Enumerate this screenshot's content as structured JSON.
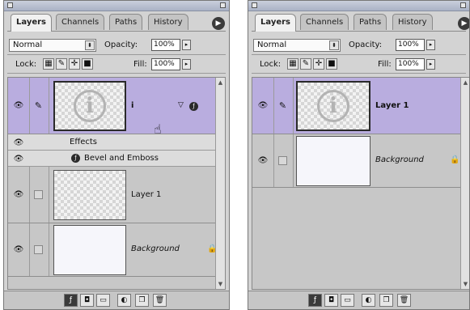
{
  "panels": [
    {
      "tabs": [
        "Layers",
        "Channels",
        "Paths",
        "History"
      ],
      "blend_mode": "Normal",
      "opacity_label": "Opacity:",
      "opacity_value": "100%",
      "lock_label": "Lock:",
      "fill_label": "Fill:",
      "fill_value": "100%",
      "layers": {
        "top_name": "i",
        "effects_label": "Effects",
        "effect_name": "Bevel and Emboss",
        "layer1_name": "Layer 1",
        "background_name": "Background"
      }
    },
    {
      "tabs": [
        "Layers",
        "Channels",
        "Paths",
        "History"
      ],
      "blend_mode": "Normal",
      "opacity_label": "Opacity:",
      "opacity_value": "100%",
      "lock_label": "Lock:",
      "fill_label": "Fill:",
      "fill_value": "100%",
      "layers": {
        "layer1_name": "Layer 1",
        "background_name": "Background"
      }
    }
  ],
  "icons": {
    "eye": "eye-icon",
    "brush": "brush-icon",
    "lock": "lock-icon",
    "effects": "effects-icon",
    "menu": "panel-menu-arrow-icon"
  },
  "colors": {
    "panel_bg": "#d3d3d3",
    "selected_row": "#b9addf",
    "titlebar": "#aab2c6"
  }
}
